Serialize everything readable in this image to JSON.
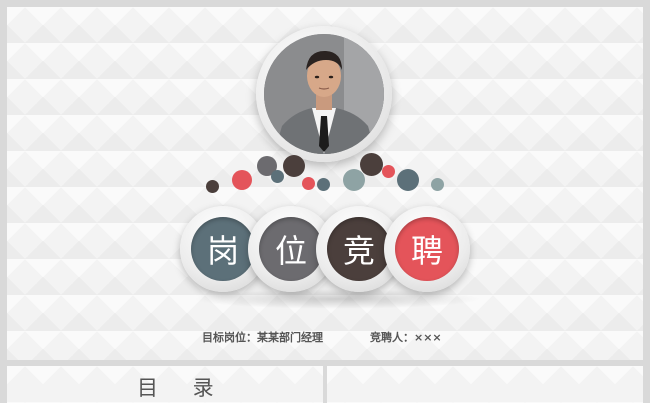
{
  "slide": {
    "title_chars": [
      "岗",
      "位",
      "竞",
      "聘"
    ],
    "char_colors": [
      "#5c7079",
      "#6c6b6f",
      "#4b3f3c",
      "#e4545a"
    ],
    "target_position_label": "目标岗位：",
    "target_position_value": "某某部门经理",
    "applicant_label": "竞聘人：",
    "applicant_value": "×××",
    "photo": "portrait-photo-man-in-suit"
  },
  "next_slides": {
    "toc_title": "目 录"
  },
  "colors": {
    "teal": "#5c7079",
    "gray": "#6c6b6f",
    "brown": "#4b3f3c",
    "red": "#e4545a",
    "light_teal": "#8ea3a4"
  }
}
